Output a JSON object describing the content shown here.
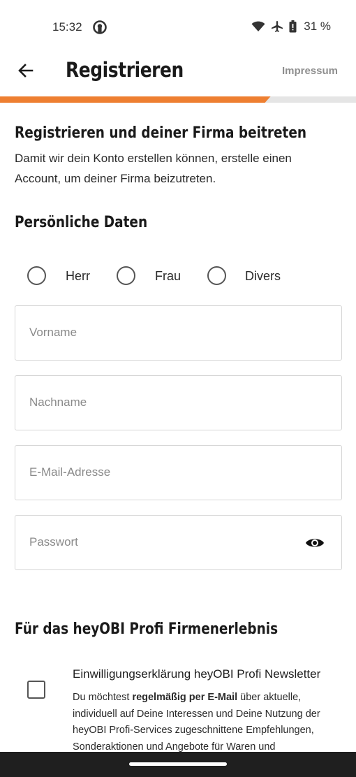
{
  "status_bar": {
    "time": "15:32",
    "battery_percent": "31 %",
    "icons": [
      "github-icon",
      "wifi-icon",
      "airplane-icon",
      "battery-icon"
    ]
  },
  "app_bar": {
    "title": "Registrieren",
    "impressum_label": "Impressum",
    "back_icon": "arrow-left-icon"
  },
  "progress": {
    "value": 0.76,
    "fill_color": "#ee7f31",
    "track_color": "#e5e5e5"
  },
  "intro": {
    "heading": "Registrieren und deiner Firma beitreten",
    "text": "Damit wir dein Konto erstellen können, erstelle einen Account, um deiner Firma beizutreten."
  },
  "personal": {
    "heading": "Persönliche Daten",
    "salutations": [
      {
        "label": "Herr",
        "selected": false
      },
      {
        "label": "Frau",
        "selected": false
      },
      {
        "label": "Divers",
        "selected": false
      }
    ],
    "fields": {
      "first_name": {
        "placeholder": "Vorname",
        "value": ""
      },
      "last_name": {
        "placeholder": "Nachname",
        "value": ""
      },
      "email": {
        "placeholder": "E-Mail-Adresse",
        "value": ""
      },
      "password": {
        "placeholder": "Passwort",
        "value": "",
        "toggle_icon": "eye-icon"
      }
    }
  },
  "profi": {
    "heading": "Für das heyOBI Profi Firmenerlebnis",
    "newsletter": {
      "checked": false,
      "title": "Einwilligungserklärung heyOBI Profi Newsletter",
      "text_before": "Du möchtest ",
      "text_bold": "regelmäßig per E-Mail",
      "text_after": " über aktuelle, individuell auf Deine Interessen und Deine Nutzung der heyOBI Profi-Services zugeschnittene Empfehlungen, Sonderaktionen und Angebote für Waren und"
    }
  },
  "colors": {
    "accent": "#ee7f31",
    "text": "#1d1d1d",
    "placeholder": "#8a8a8a",
    "border": "#d6d6d6"
  }
}
